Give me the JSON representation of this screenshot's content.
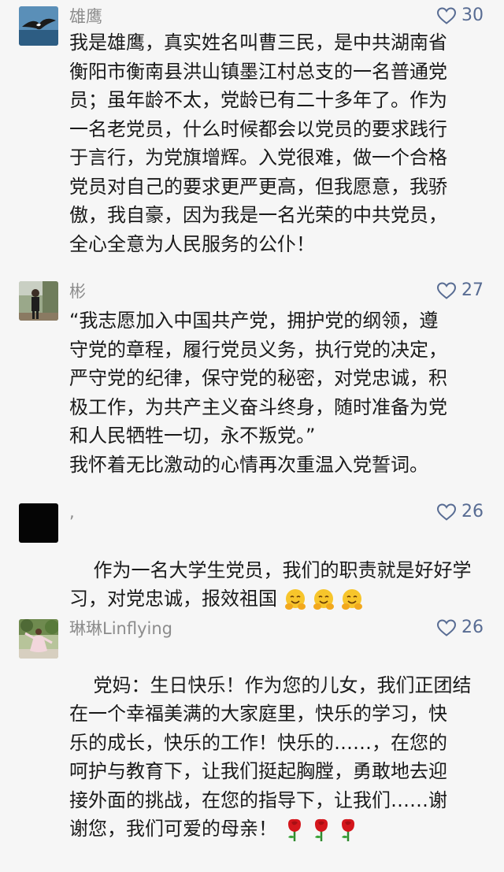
{
  "comments": [
    {
      "nickname": "雄鹰",
      "likes": "30",
      "text": "我是雄鹰，真实姓名叫曹三民，是中共湖南省\n衡阳市衡南县洪山镇墨江村总支的一名普通党\n员；虽年龄不太，党龄已有二十多年了。作为\n一名老党员，什么时候都会以党员的要求践行\n于言行，为党旗增辉。入党很难，做一个合格\n党员对自己的要求更严更高，但我愿意，我骄\n傲，我自豪，因为我是一名光荣的中共党员，\n全心全意为人民服务的公仆！",
      "avatar_icon": "eagle-avatar"
    },
    {
      "nickname": "彬",
      "likes": "27",
      "text": "“我志愿加入中国共产党，拥护党的纲领，遵\n守党的章程，履行党员义务，执行党的决定，\n严守党的纪律，保守党的秘密，对党忠诚，积\n极工作，为共产主义奋斗终身，随时准备为党\n和人民牺牲一切，永不叛党。”\n我怀着无比激动的心情再次重温入党誓词。",
      "avatar_icon": "person-photo-avatar"
    },
    {
      "nickname": ",",
      "likes": "26",
      "text": "作为一名大学生党员，我们的职责就是好好学\n习，对党忠诚，报效祖国",
      "emoji": [
        "hugging-face-emoji",
        "hugging-face-emoji",
        "hugging-face-emoji"
      ],
      "avatar_icon": "black-avatar"
    },
    {
      "nickname": "琳琳Linflying",
      "likes": "26",
      "text": "党妈：生日快乐！作为您的儿女，我们正团结\n在一个幸福美满的大家庭里，快乐的学习，快\n乐的成长，快乐的工作！快乐的……，在您的\n呵护与教育下，让我们挺起胸膛，勇敢地去迎\n接外面的挑战，在您的指导下，让我们……谢\n谢您，我们可爱的母亲！",
      "emoji": [
        "rose-emoji",
        "rose-emoji",
        "rose-emoji"
      ],
      "avatar_icon": "dancer-photo-avatar"
    }
  ],
  "colors": {
    "background": "#f6f6f6",
    "nickname": "#8c8c8c",
    "like": "#586c93",
    "text": "#1a1a1a"
  }
}
